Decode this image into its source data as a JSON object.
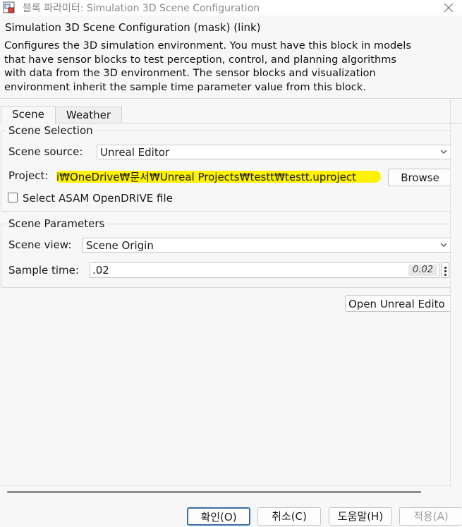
{
  "window": {
    "title": "블록 파라미터: Simulation 3D Scene Configuration",
    "icons": {
      "app": "simulink-block-icon",
      "close": "close-icon"
    }
  },
  "mask": {
    "header": "Simulation 3D Scene Configuration (mask) (link)",
    "description_lines": [
      "Configures the 3D simulation environment. You must have this block in models",
      "that have sensor blocks to test perception, control, and planning algorithms",
      "with data from the 3D environment. The sensor blocks and visualization",
      "environment inherit the sample time parameter value from this block."
    ]
  },
  "tabs": [
    {
      "label": "Scene",
      "active": true
    },
    {
      "label": "Weather",
      "active": false
    }
  ],
  "scene_selection": {
    "title": "Scene Selection",
    "source_label": "Scene source:",
    "source_value": "Unreal Editor",
    "project_label": "Project:",
    "project_value": "i₩OneDrive₩문서₩Unreal Projects₩testt₩testt.uproject",
    "browse_label": "Browse",
    "opendrive_label": "Select ASAM OpenDRIVE file",
    "opendrive_checked": false
  },
  "scene_parameters": {
    "title": "Scene Parameters",
    "view_label": "Scene view:",
    "view_value": "Scene Origin",
    "sample_time_label": "Sample time:",
    "sample_time_value": ".02",
    "sample_time_evaluated": "0.02"
  },
  "open_editor_label": "Open Unreal Edito",
  "dialog_buttons": {
    "ok": "확인(O)",
    "cancel": "취소(C)",
    "help": "도움말(H)",
    "apply": "적용(A)"
  },
  "colors": {
    "highlight": "#fff200",
    "focus_border": "#3b6ea5",
    "disabled_text": "#a0a0a0"
  }
}
